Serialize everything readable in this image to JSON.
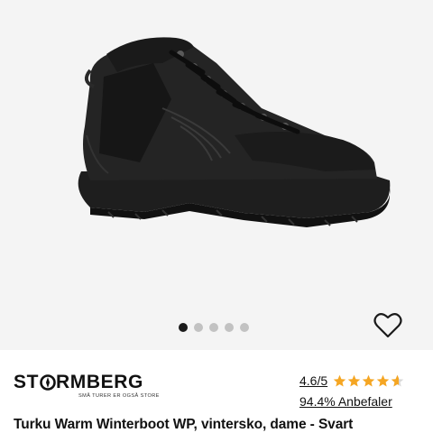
{
  "gallery": {
    "image_alt": "Black winter hiking boot",
    "image_count": 5,
    "active_index": 0
  },
  "icons": {
    "favorite": "heart-outline-icon",
    "star": "star-icon"
  },
  "brand": {
    "name_part1": "ST",
    "name_part2": "RMBERG",
    "tagline": "SMÅ TURER ER OGSÅ STORE"
  },
  "rating": {
    "score_label": "4.6/5",
    "stars": 4.6,
    "recommend_label": "94.4% Anbefaler"
  },
  "product": {
    "title": "Turku Warm Winterboot WP, vintersko, dame - Svart"
  },
  "colors": {
    "gallery_bg": "#f4f4f4",
    "star": "#f5a623",
    "dot_active": "#1a1a1a",
    "dot_inactive": "#c2c2c2"
  }
}
